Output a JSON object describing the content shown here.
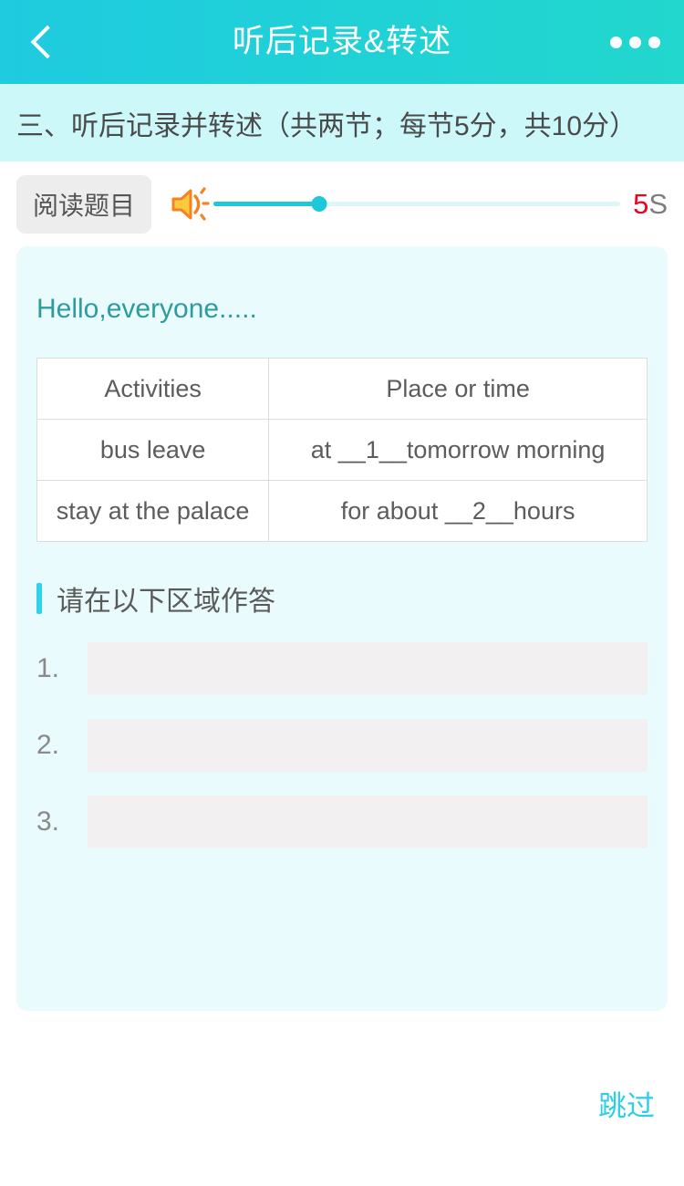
{
  "header": {
    "title": "听后记录&转述",
    "back_icon": "chevron-left-icon",
    "more_icon": "more-dots-icon",
    "gradient_start": "#1ECBDF",
    "gradient_end": "#22D7CE"
  },
  "section_banner": {
    "text": "三、听后记录并转述（共两节；每节5分，共10分）",
    "background": "#CDF8FA"
  },
  "audio": {
    "read_button_label": "阅读题目",
    "speaker_icon": "speaker-icon",
    "progress_percent": 26,
    "timer_number": "5",
    "timer_unit": "S",
    "timer_number_color": "#F2001E",
    "track_fill_color": "#1FC7DA"
  },
  "passage": {
    "greeting": "Hello,everyone....."
  },
  "table": {
    "headers": [
      "Activities",
      "Place or time"
    ],
    "rows": [
      [
        "bus leave",
        "at __1__tomorrow morning"
      ],
      [
        "stay at the palace",
        "for about __2__hours"
      ]
    ]
  },
  "answer_section": {
    "heading": "请在以下区域作答",
    "accent_color": "#2DD3E6",
    "items": [
      {
        "number": "1.",
        "value": "",
        "placeholder": ""
      },
      {
        "number": "2.",
        "value": "",
        "placeholder": ""
      },
      {
        "number": "3.",
        "value": "",
        "placeholder": ""
      }
    ]
  },
  "footer": {
    "skip_label": "跳过",
    "skip_color": "#2ACFE4"
  }
}
